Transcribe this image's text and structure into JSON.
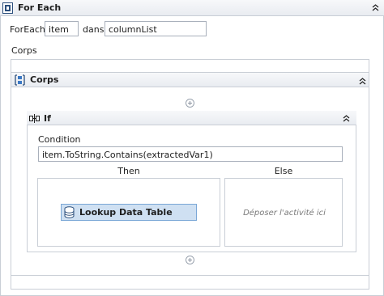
{
  "foreach": {
    "title": "For Each",
    "foreach_label": "ForEach",
    "item_value": "item",
    "in_label": "dans",
    "collection_value": "columnList",
    "body_label": "Corps"
  },
  "sequence": {
    "title": "Corps"
  },
  "if_activity": {
    "title": "If",
    "condition_label": "Condition",
    "condition_value": "item.ToString.Contains(extractedVar1)",
    "then_label": "Then",
    "else_label": "Else",
    "else_placeholder": "Déposer l'activité ici"
  },
  "then_activity": {
    "label": "Lookup Data Table"
  },
  "icons": {
    "foreach": "foreach-icon",
    "sequence": "sequence-icon",
    "if": "if-icon",
    "lookup": "database-icon",
    "collapse": "chevron-up-icon",
    "add": "plus-circle-icon"
  },
  "colors": {
    "header_bg": "#eceff3",
    "selected_activity_bg": "#cfe0f2",
    "selected_activity_border": "#7aa7d6",
    "border": "#c9ced6"
  }
}
